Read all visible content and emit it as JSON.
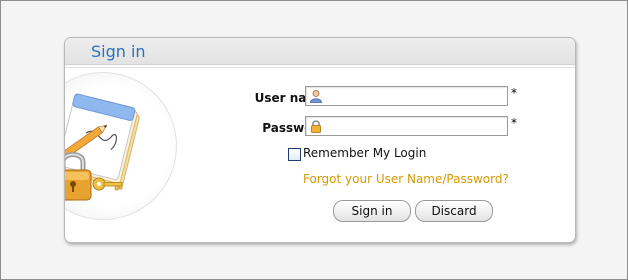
{
  "header": {
    "title": "Sign in"
  },
  "form": {
    "username": {
      "label": "User name",
      "value": "",
      "placeholder": "",
      "required_mark": "*",
      "icon": "user-icon"
    },
    "password": {
      "label": "Password",
      "value": "",
      "placeholder": "",
      "required_mark": "*",
      "icon": "lock-icon"
    },
    "remember": {
      "label": "Remember My Login",
      "checked": false
    },
    "forgot_link": "Forgot your User Name/Password?"
  },
  "buttons": {
    "signin": "Sign in",
    "discard": "Discard"
  },
  "colors": {
    "title": "#2b6fc2",
    "link": "#d79a00"
  },
  "illustration": "notepad-pencil-padlock-key-icon"
}
